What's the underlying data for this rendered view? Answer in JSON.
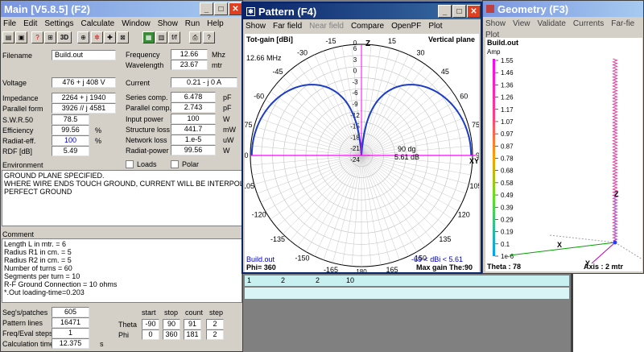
{
  "main": {
    "title": "Main [V5.8.5]  (F2)",
    "menu": [
      "File",
      "Edit",
      "Settings",
      "Calculate",
      "Window",
      "Show",
      "Run",
      "Help"
    ],
    "toolbar_3d": "3D",
    "toolbar_ff": "f/f",
    "fields": {
      "filename_label": "Filename",
      "filename": "Build.out",
      "frequency_label": "Frequency",
      "frequency": "12.66",
      "frequency_unit": "Mhz",
      "wavelength_label": "Wavelength",
      "wavelength": "23.67",
      "wavelength_unit": "mtr",
      "voltage_label": "Voltage",
      "voltage": "476 + j 408 V",
      "current_label": "Current",
      "current": "0.21 - j 0 A",
      "impedance_label": "Impedance",
      "impedance": "2264 + j 1940",
      "series_label": "Series comp.",
      "series": "6.478",
      "series_unit": "pF",
      "parallel_form_label": "Parallel form",
      "parallel_form": "3926 // j 4581",
      "parallel_comp_label": "Parallel comp.",
      "parallel_comp": "2.743",
      "parallel_comp_unit": "pF",
      "swr_label": "S.W.R.50",
      "swr": "78.5",
      "input_power_label": "Input power",
      "input_power": "100",
      "input_power_unit": "W",
      "efficiency_label": "Efficiency",
      "efficiency": "99.56",
      "efficiency_unit": "%",
      "structure_loss_label": "Structure loss",
      "structure_loss": "441.7",
      "structure_loss_unit": "mW",
      "radiat_eff_label": "Radiat-eff.",
      "radiat_eff": "100",
      "radiat_eff_unit": "%",
      "network_loss_label": "Network loss",
      "network_loss": "1.e-5",
      "network_loss_unit": "uW",
      "rdf_label": "RDF [dB]",
      "rdf": "5.49",
      "radiat_power_label": "Radiat-power",
      "radiat_power": "99.56",
      "radiat_power_unit": "W",
      "environment_label": "Environment",
      "loads_label": "Loads",
      "polar_label": "Polar"
    },
    "messages": [
      "GROUND PLANE SPECIFIED.",
      "WHERE WIRE ENDS TOUCH GROUND, CURRENT WILL BE INTERPOLAT",
      "PERFECT GROUND"
    ],
    "comment_label": "Comment",
    "comments": [
      "Length L in mtr. = 6",
      "Radius R1 in cm. = 5",
      "Radius R2 in cm. = 5",
      "Number of turns = 60",
      "Segments per turn = 10",
      "R-F Ground Connection = 10 ohms",
      "*.Out loading-time=0.203"
    ],
    "bottom": {
      "segs_label": "Seg's/patches",
      "segs": "605",
      "pattern_lines_label": "Pattern lines",
      "pattern_lines": "16471",
      "freq_steps_label": "Freq/Eval steps",
      "freq_steps": "1",
      "calc_time_label": "Calculation time",
      "calc_time": "12.375",
      "calc_time_unit": "s",
      "col_start": "start",
      "col_stop": "stop",
      "col_count": "count",
      "col_step": "step",
      "theta_label": "Theta",
      "theta": [
        "-90",
        "90",
        "91",
        "2"
      ],
      "phi_label": "Phi",
      "phi": [
        "0",
        "360",
        "181",
        "2"
      ]
    }
  },
  "pattern": {
    "title": "Pattern     (F4)",
    "menu": [
      "Show",
      "Far field",
      "Near field",
      "Compare",
      "OpenPF",
      "Plot"
    ],
    "tot_gain": "Tot-gain [dBi]",
    "plane": "Vertical plane",
    "freq": "12.66 MHz",
    "z_label": "Z",
    "xy_label": "XY",
    "center_readout_1": "90 dg",
    "center_readout_2": "5.61 dB",
    "file": "Build.out",
    "phi": "Phi= 360",
    "range": "-69 < dBi < 5.61",
    "max_gain": "Max gain The:90",
    "angle_labels": [
      "0",
      "15",
      "30",
      "45",
      "60",
      "75",
      "90",
      "105",
      "120",
      "135",
      "150",
      "165",
      "180",
      "-15",
      "-30",
      "-45",
      "-60",
      "-75",
      "-90",
      "-105",
      "-120",
      "-135",
      "-150",
      "-165"
    ],
    "radial_labels": [
      "6",
      "3",
      "0",
      "-3",
      "-6",
      "-9",
      "-12",
      "-15",
      "-18",
      "-21",
      "-24"
    ],
    "line_color": "#1a3cc8",
    "axis_color": "#ff00ff"
  },
  "geometry": {
    "title": "Geometry     (F3)",
    "menu": [
      "Show",
      "View",
      "Validate",
      "Currents",
      "Far-fie"
    ],
    "menu2": "Plot",
    "file": "Build.out",
    "amp_label": "Amp",
    "scale": [
      "1.55",
      "1.46",
      "1.36",
      "1.26",
      "1.17",
      "1.07",
      "0.97",
      "0.87",
      "0.78",
      "0.68",
      "0.58",
      "0.49",
      "0.39",
      "0.29",
      "0.19",
      "0.1",
      "1e-6"
    ],
    "theta": "Theta : 78",
    "axis": "Axis : 2 mtr",
    "x_label": "X",
    "y_label": "Y",
    "z_label": "Z"
  },
  "row_strip": [
    "1",
    "2",
    "2",
    "10"
  ]
}
